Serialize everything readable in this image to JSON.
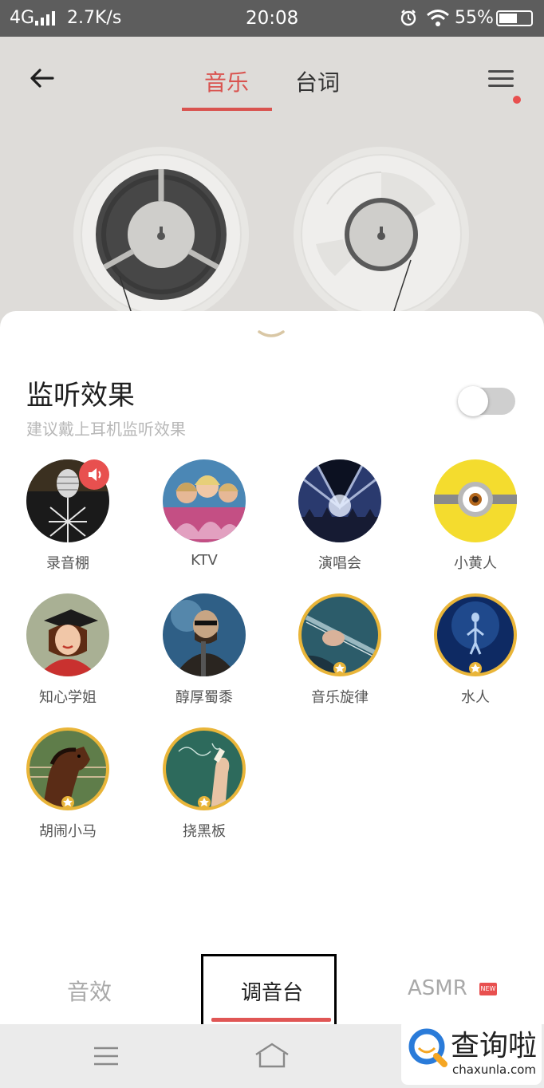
{
  "status_bar": {
    "network": "4G",
    "speed": "2.7K/s",
    "time": "20:08",
    "battery": "55%"
  },
  "header": {
    "tab_music": "音乐",
    "tab_lyrics": "台词",
    "accent_color": "#d9534f"
  },
  "monitor": {
    "title": "监听效果",
    "subtitle": "建议戴上耳机监听效果",
    "enabled": false
  },
  "effects": [
    {
      "label": "录音棚",
      "icon": "studio-mic",
      "premium": false,
      "playing": true
    },
    {
      "label": "KTV",
      "icon": "ktv-singers",
      "premium": false,
      "playing": false
    },
    {
      "label": "演唱会",
      "icon": "concert-stage",
      "premium": false,
      "playing": false
    },
    {
      "label": "小黄人",
      "icon": "minion-eye",
      "premium": false,
      "playing": false
    },
    {
      "label": "知心学姐",
      "icon": "graduate-girl",
      "premium": false,
      "playing": false
    },
    {
      "label": "醇厚蜀黍",
      "icon": "bearded-singer",
      "premium": false,
      "playing": false
    },
    {
      "label": "音乐旋律",
      "icon": "guitar-player",
      "premium": true,
      "playing": false
    },
    {
      "label": "水人",
      "icon": "underwater-diver",
      "premium": true,
      "playing": false
    },
    {
      "label": "胡闹小马",
      "icon": "horse",
      "premium": true,
      "playing": false
    },
    {
      "label": "挠黑板",
      "icon": "chalkboard",
      "premium": true,
      "playing": false
    }
  ],
  "bottom_tabs": [
    {
      "label": "音效",
      "active": false
    },
    {
      "label": "调音台",
      "active": true
    },
    {
      "label": "ASMR",
      "active": false,
      "badge": "NEW"
    }
  ],
  "watermark": {
    "name": "查询啦",
    "url": "chaxunla.com"
  }
}
